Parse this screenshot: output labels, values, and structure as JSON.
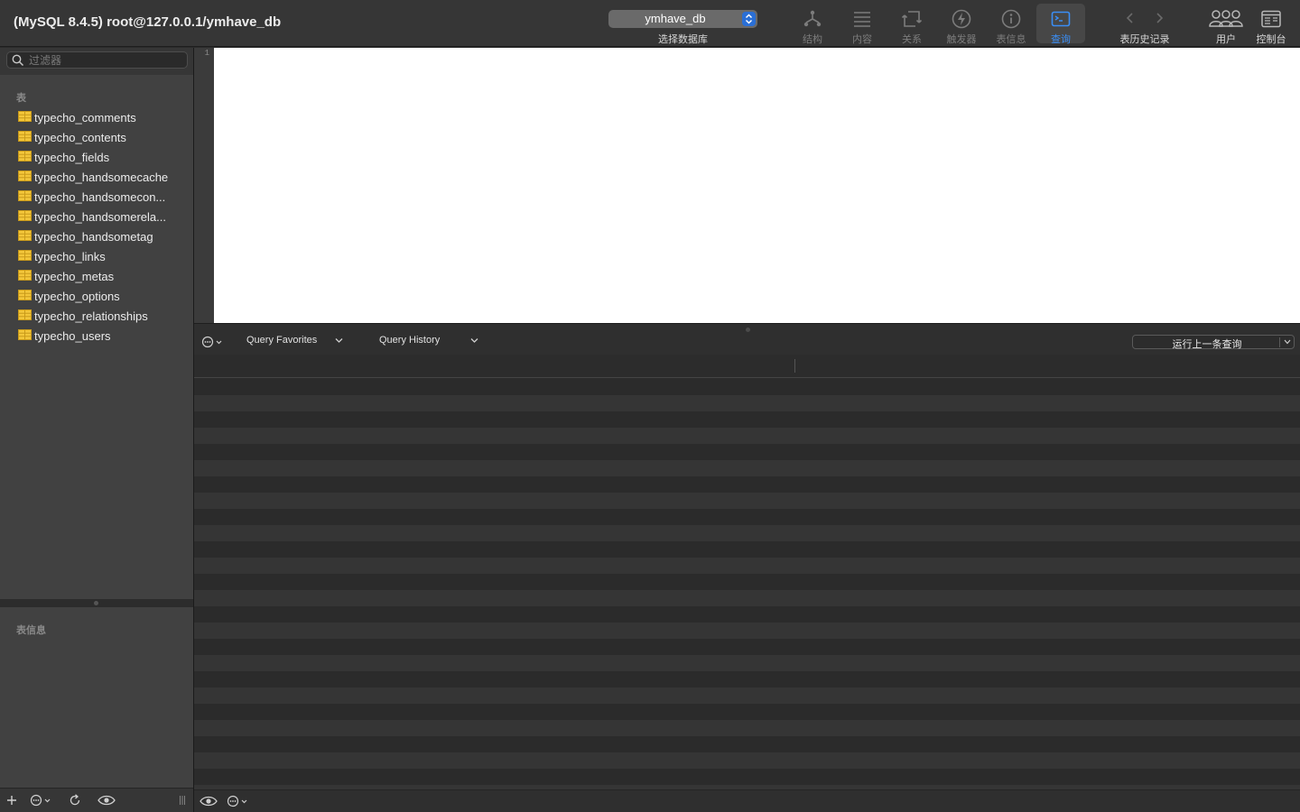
{
  "window": {
    "title": "(MySQL 8.4.5) root@127.0.0.1/ymhave_db"
  },
  "database_selector": {
    "value": "ymhave_db",
    "caption": "选择数据库"
  },
  "toolbar": {
    "structure": "结构",
    "content": "内容",
    "relations": "关系",
    "triggers": "触发器",
    "table_info": "表信息",
    "query": "查询",
    "history": "表历史记录",
    "users": "用户",
    "console": "控制台",
    "active_tab": "query",
    "accent_color": "#3a8ef6"
  },
  "sidebar": {
    "filter_placeholder": "过滤器",
    "tables_header": "表",
    "tables": [
      {
        "name": "typecho_comments"
      },
      {
        "name": "typecho_contents"
      },
      {
        "name": "typecho_fields"
      },
      {
        "name": "typecho_handsomecache"
      },
      {
        "name": "typecho_handsomecon..."
      },
      {
        "name": "typecho_handsomerela..."
      },
      {
        "name": "typecho_handsometag"
      },
      {
        "name": "typecho_links"
      },
      {
        "name": "typecho_metas"
      },
      {
        "name": "typecho_options"
      },
      {
        "name": "typecho_relationships"
      },
      {
        "name": "typecho_users"
      }
    ],
    "table_info_header": "表信息"
  },
  "editor": {
    "line_number": "1",
    "content": ""
  },
  "query_bar": {
    "favorites": "Query Favorites",
    "history": "Query History",
    "run_previous": "运行上一条查询"
  }
}
